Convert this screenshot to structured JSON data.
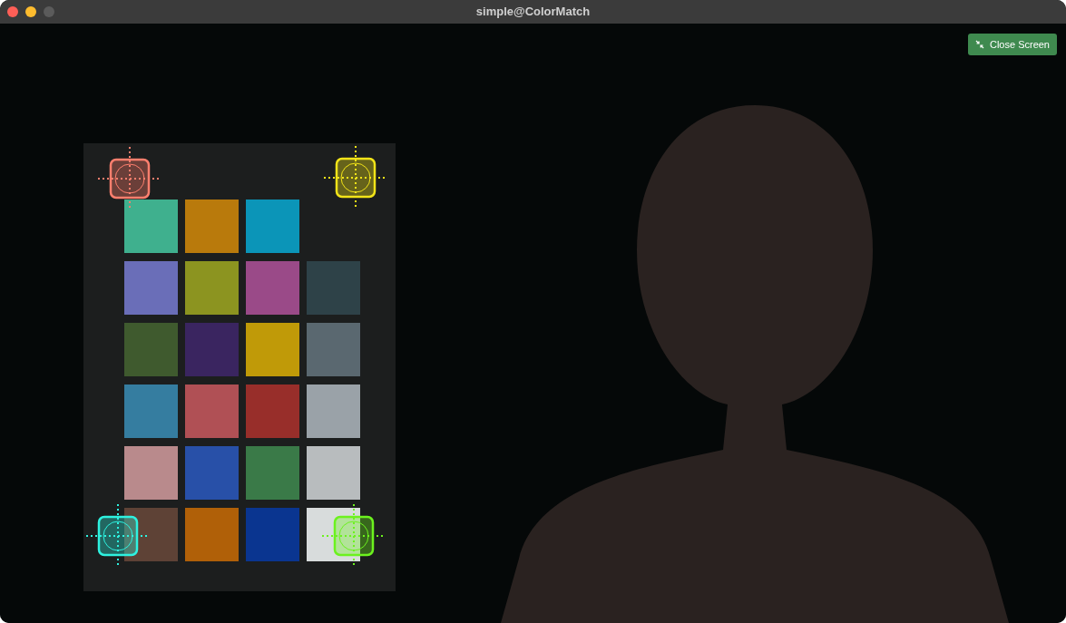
{
  "window": {
    "title": "simple@ColorMatch"
  },
  "close_button": {
    "label": "Close Screen"
  },
  "markers": [
    {
      "color": "#ff7f6e"
    },
    {
      "color": "#f2e418"
    },
    {
      "color": "#2ef2e0"
    },
    {
      "color": "#6cf21e"
    }
  ]
}
